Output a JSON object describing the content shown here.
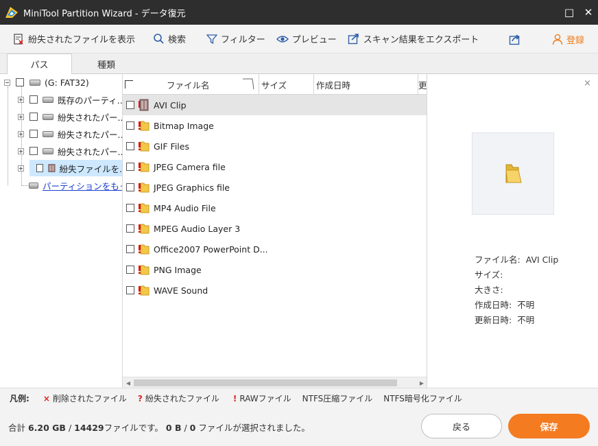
{
  "window": {
    "title": "MiniTool Partition Wizard - データ復元",
    "maximize_glyph": "□",
    "close_glyph": "✕"
  },
  "toolbar": {
    "show_lost_files": "紛失されたファイルを表示",
    "search": "検索",
    "filter": "フィルター",
    "preview": "プレビュー",
    "export_results": "スキャン結果をエクスポート",
    "register": "登録"
  },
  "tabs": {
    "path": "パス",
    "type": "種類"
  },
  "tree": {
    "root": "(G: FAT32)",
    "items": [
      {
        "label": "既存のパーティ..."
      },
      {
        "label": "紛失されたパー..."
      },
      {
        "label": "紛失されたパー..."
      },
      {
        "label": "紛失されたパー..."
      },
      {
        "label": "紛失ファイルを..."
      }
    ],
    "link": "パーティションをもっ..."
  },
  "file_list": {
    "columns": {
      "name": "ファイル名",
      "size": "サイズ",
      "created": "作成日時",
      "modified": "更"
    },
    "rows": [
      {
        "name": "AVI Clip",
        "selected": true,
        "icon": "raw-file-icon"
      },
      {
        "name": "Bitmap Image",
        "icon": "lost-folder-icon"
      },
      {
        "name": "GIF Files",
        "icon": "lost-folder-icon"
      },
      {
        "name": "JPEG Camera file",
        "icon": "lost-folder-icon"
      },
      {
        "name": "JPEG Graphics file",
        "icon": "lost-folder-icon"
      },
      {
        "name": "MP4 Audio File",
        "icon": "lost-folder-icon"
      },
      {
        "name": "MPEG Audio Layer 3",
        "icon": "lost-folder-icon"
      },
      {
        "name": "Office2007 PowerPoint D...",
        "icon": "lost-folder-icon"
      },
      {
        "name": "PNG Image",
        "icon": "lost-folder-icon"
      },
      {
        "name": "WAVE Sound",
        "icon": "lost-folder-icon"
      }
    ]
  },
  "preview": {
    "close_glyph": "×",
    "filename_label": "ファイル名:",
    "filename_value": "AVI Clip",
    "size_label": "サイズ:",
    "size_value": "",
    "dimensions_label": "大きさ:",
    "dimensions_value": "",
    "created_label": "作成日時:",
    "created_value": "不明",
    "modified_label": "更新日時:",
    "modified_value": "不明"
  },
  "legend": {
    "title": "凡例:",
    "deleted": "削除されたファイル",
    "lost": "紛失されたファイル",
    "raw": "RAWファイル",
    "ntfs_compressed": "NTFS圧縮ファイル",
    "ntfs_encrypted": "NTFS暗号化ファイル",
    "deleted_mark": "×",
    "lost_mark": "?",
    "raw_mark": "!"
  },
  "summary": {
    "total_label": "合計 ",
    "total_size": "6.20 GB",
    "sep": " / ",
    "file_count": "14429",
    "files_text": "ファイルです。",
    "selected_size": "0 B",
    "selected_count": "0",
    "selected_text": " ファイルが選択されました。"
  },
  "buttons": {
    "back": "戻る",
    "save": "保存"
  },
  "colors": {
    "accent": "#f47b20",
    "link": "#1a3fd0",
    "lost_mark": "#e02020"
  }
}
